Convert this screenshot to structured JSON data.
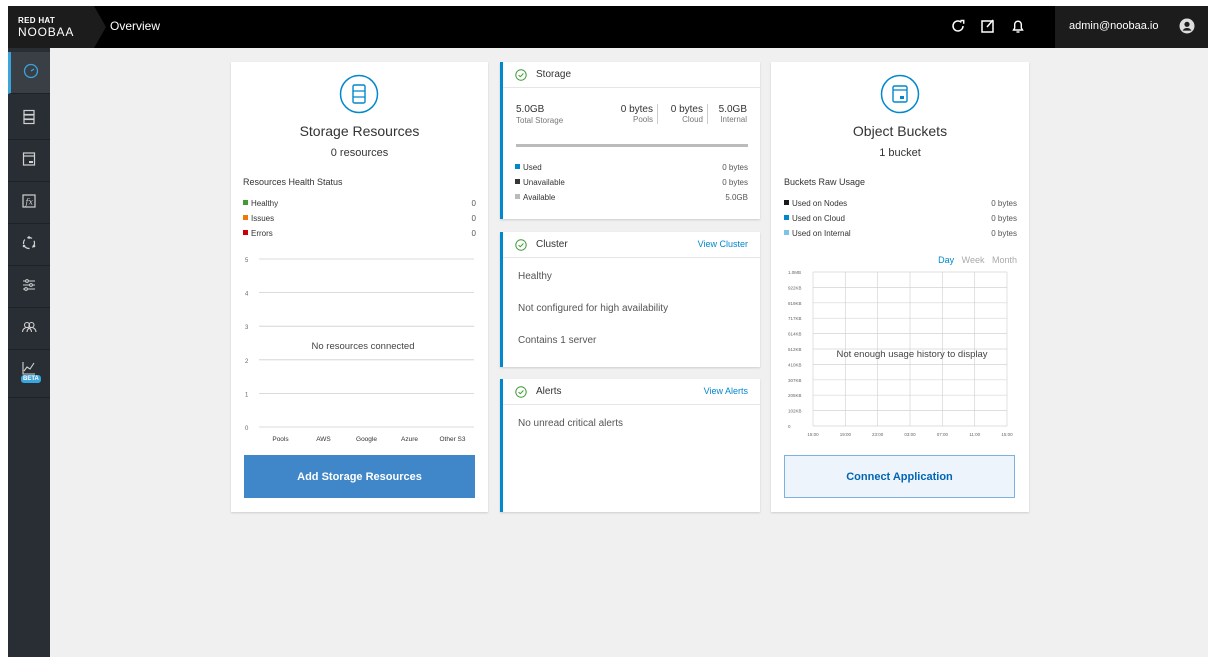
{
  "header": {
    "brand_top": "RED HAT",
    "brand_bottom": "NOOBAA",
    "page_title": "Overview",
    "user": "admin@noobaa.io",
    "icons": [
      "refresh-icon",
      "edit-icon",
      "bell-icon",
      "user-icon"
    ]
  },
  "sidebar": {
    "items": [
      {
        "name": "overview",
        "icon": "gauge-icon",
        "active": true
      },
      {
        "name": "resources",
        "icon": "server-icon"
      },
      {
        "name": "buckets",
        "icon": "bucket-icon"
      },
      {
        "name": "functions",
        "icon": "function-icon"
      },
      {
        "name": "cluster",
        "icon": "cluster-icon"
      },
      {
        "name": "management",
        "icon": "sliders-icon"
      },
      {
        "name": "accounts",
        "icon": "users-icon"
      },
      {
        "name": "analytics",
        "icon": "chart-icon",
        "badge": "BETA"
      }
    ]
  },
  "resources_card": {
    "title": "Storage Resources",
    "count": "0 resources",
    "health_title": "Resources Health Status",
    "health": [
      {
        "label": "Healthy",
        "value": "0",
        "color": "#3f9c35"
      },
      {
        "label": "Issues",
        "value": "0",
        "color": "#ec7a08"
      },
      {
        "label": "Errors",
        "value": "0",
        "color": "#cc0000"
      }
    ],
    "chart_message": "No resources connected",
    "button": "Add Storage Resources"
  },
  "chart_data": [
    {
      "type": "bar",
      "categories": [
        "Pools",
        "AWS",
        "Google",
        "Azure",
        "Other S3"
      ],
      "values": [
        0,
        0,
        0,
        0,
        0
      ],
      "ylim": [
        0,
        5
      ],
      "yticks": [
        "0",
        "1",
        "2",
        "3",
        "4",
        "5"
      ],
      "grid": true
    },
    {
      "type": "line",
      "xticks": [
        "15:00",
        "19:00",
        "23:00",
        "03:00",
        "07:00",
        "11:00",
        "15:00"
      ],
      "yticks": [
        "0",
        "102KB",
        "205KB",
        "307KB",
        "410KB",
        "512KB",
        "614KB",
        "717KB",
        "819KB",
        "922KB",
        "1.0MB"
      ],
      "series": [],
      "grid": true
    }
  ],
  "storage_card": {
    "title": "Storage",
    "total_value": "5.0GB",
    "total_label": "Total Storage",
    "breakdown": [
      {
        "value": "0 bytes",
        "label": "Pools"
      },
      {
        "value": "0 bytes",
        "label": "Cloud"
      },
      {
        "value": "5.0GB",
        "label": "Internal"
      }
    ],
    "legend": [
      {
        "label": "Used",
        "value": "0 bytes",
        "color": "#0088ce"
      },
      {
        "label": "Unavailable",
        "value": "0 bytes",
        "color": "#363636"
      },
      {
        "label": "Available",
        "value": "5.0GB",
        "color": "#bbbbbb"
      }
    ]
  },
  "cluster_card": {
    "title": "Cluster",
    "link": "View Cluster",
    "lines": [
      "Healthy",
      "Not configured for high availability",
      "Contains 1 server"
    ]
  },
  "alerts_card": {
    "title": "Alerts",
    "link": "View Alerts",
    "message": "No unread critical alerts"
  },
  "buckets_card": {
    "title": "Object Buckets",
    "count": "1 bucket",
    "usage_title": "Buckets Raw Usage",
    "legend": [
      {
        "label": "Used on Nodes",
        "value": "0 bytes",
        "color": "#1a1a1a"
      },
      {
        "label": "Used on Cloud",
        "value": "0 bytes",
        "color": "#0088ce"
      },
      {
        "label": "Used on Internal",
        "value": "0 bytes",
        "color": "#7dc3e8"
      }
    ],
    "ranges": [
      "Day",
      "Week",
      "Month"
    ],
    "selected_range": "Day",
    "chart_message": "Not enough usage history to display",
    "button": "Connect Application"
  }
}
